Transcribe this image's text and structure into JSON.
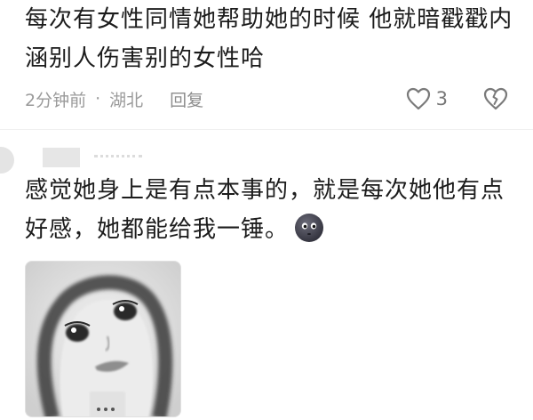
{
  "comments": [
    {
      "text": "每次有女性同情她帮助她的时候 他就暗戳戳内涵别人伤害别的女性哈",
      "meta": {
        "time": "2分钟前",
        "separator": "·",
        "location": "湖北",
        "reply_label": "回复",
        "like_count": "3"
      }
    },
    {
      "user_name": "",
      "text": "感觉她身上是有点本事的，就是每次她他有点好感，她都能给我一锤。",
      "emoji": "dark-face-emoji",
      "attachment": "sticker-image"
    }
  ],
  "icons": {
    "like": "heart-outline-icon",
    "dislike": "broken-heart-icon"
  },
  "colors": {
    "text": "#1c1c1c",
    "meta": "#9a9a9a",
    "emoji_face": "#4a4a56"
  }
}
